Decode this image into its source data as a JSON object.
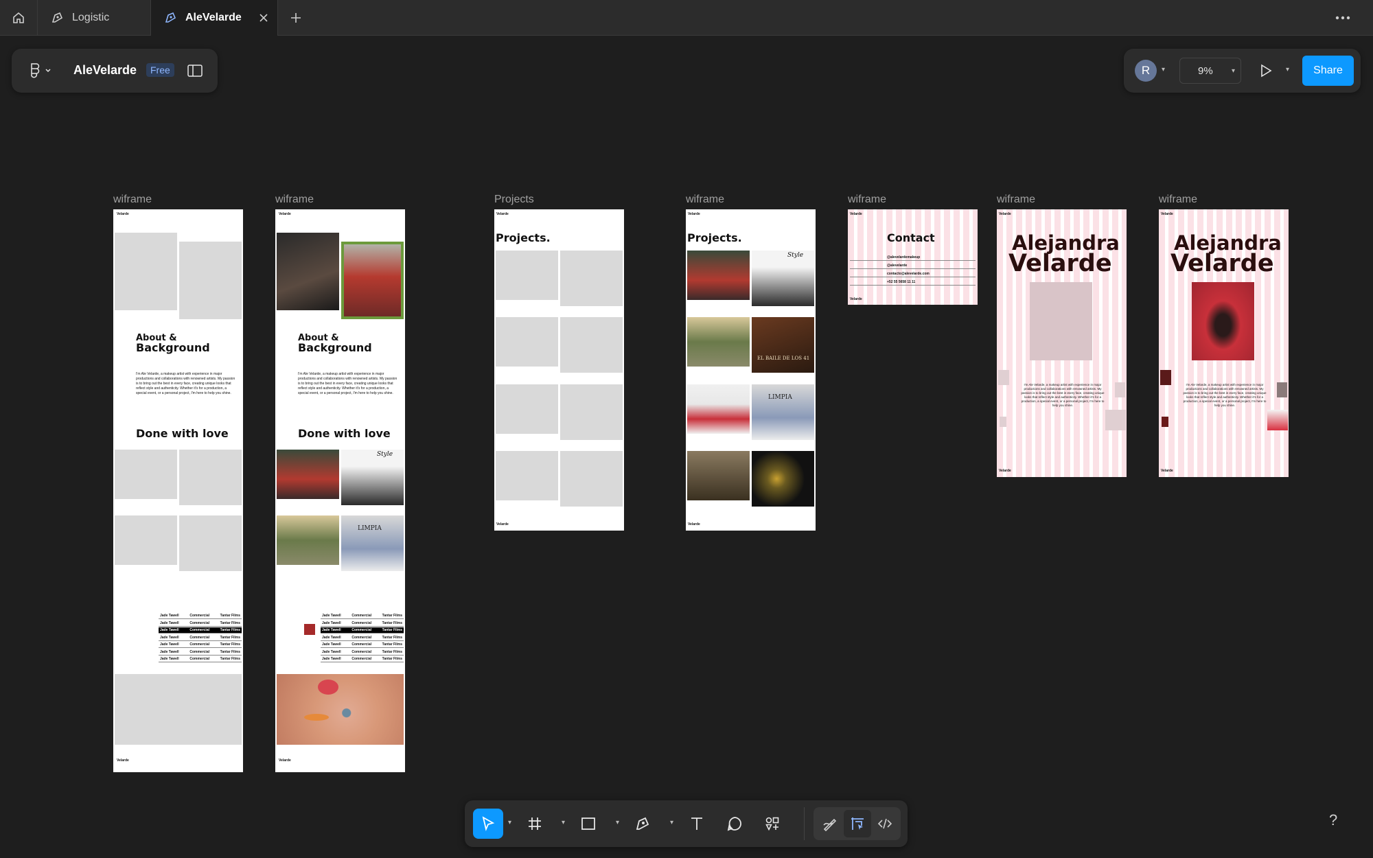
{
  "tabs": [
    {
      "label": "Logistic"
    },
    {
      "label": "AleVelarde"
    }
  ],
  "file": {
    "name": "AleVelarde",
    "plan_badge": "Free"
  },
  "toolbar_right": {
    "avatar_initial": "R",
    "zoom": "9%",
    "share_label": "Share"
  },
  "frames": [
    {
      "label": "wiframe"
    },
    {
      "label": "wiframe"
    },
    {
      "label": "Projects"
    },
    {
      "label": "wiframe"
    },
    {
      "label": "wiframe"
    },
    {
      "label": "wiframe"
    },
    {
      "label": "wiframe"
    }
  ],
  "content": {
    "logo": "Velarde",
    "about_title_1": "About &",
    "about_title_2": "Background",
    "about_text": "I'm Ale Velarde, a makeup artist with experience in major productions and collaborations with renowned artists. My passion is to bring out the best in every face, creating unique looks that reflect style and authenticity. Whether it's for a production, a special event, or a personal project, I'm here to help you shine.",
    "done_title": "Done with love",
    "projects_title": "Projects.",
    "contact_title": "Contact",
    "contact_items": [
      "@alevelardemakeup",
      "@alevelarde",
      "contacto@alevelarde.com",
      "+52 55 5658 11 11"
    ],
    "hero_first": "Alejandra",
    "hero_last": "Velarde",
    "card_name": "Jade Tawell",
    "card_studio": "Tantar Films",
    "table_col2": "Commercial",
    "poster_text_1": "EL BAILE DE LOS 41",
    "poster_text_2": "LIMPIA",
    "poster_text_3": "Style"
  },
  "help_label": "?"
}
